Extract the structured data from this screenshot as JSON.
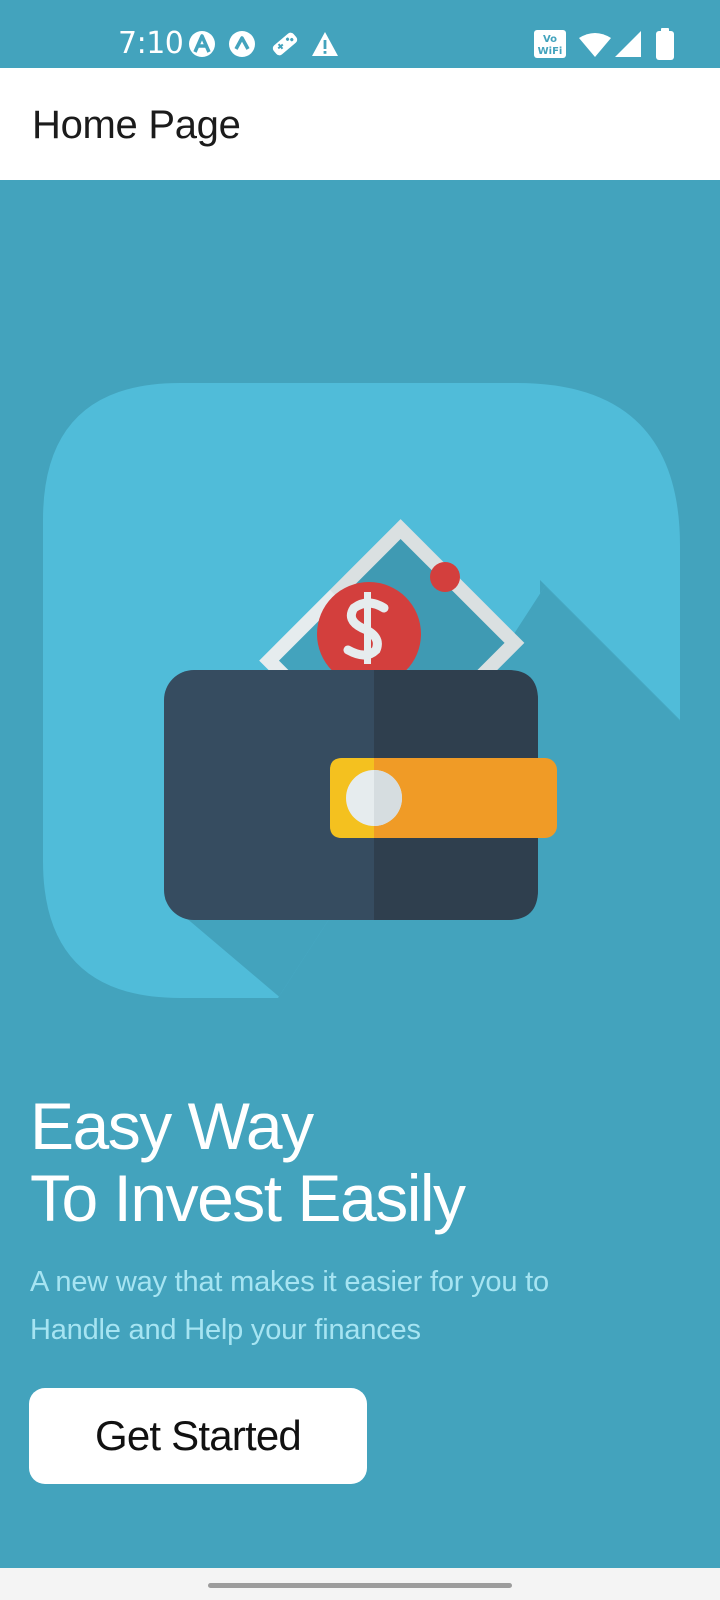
{
  "status_bar": {
    "time": "7:10",
    "notification_icons": [
      "app-a-icon",
      "app-a-circle-icon",
      "game-controller-icon",
      "warning-icon"
    ],
    "system_icons": [
      "vowifi-icon",
      "wifi-icon",
      "signal-icon",
      "battery-icon"
    ],
    "vowifi_line1": "Vo",
    "vowifi_line2": "WiFi"
  },
  "app_bar": {
    "title": "Home Page"
  },
  "hero": {
    "headline_line1": "Easy Way",
    "headline_line2": "To Invest Easily",
    "subtitle_line1": "A new way that makes it easier for you to",
    "subtitle_line2": "Handle and Help your finances",
    "cta_label": "Get Started"
  },
  "colors": {
    "background": "#43a3bd",
    "illustration_bubble": "#50bcd9",
    "wallet": "#364c60",
    "wallet_shadow": "#2f3f4e",
    "clasp": "#f09b26",
    "banknote_accent": "#d33f3d",
    "subtitle_text": "#a6e4f2",
    "button_background": "#ffffff"
  }
}
